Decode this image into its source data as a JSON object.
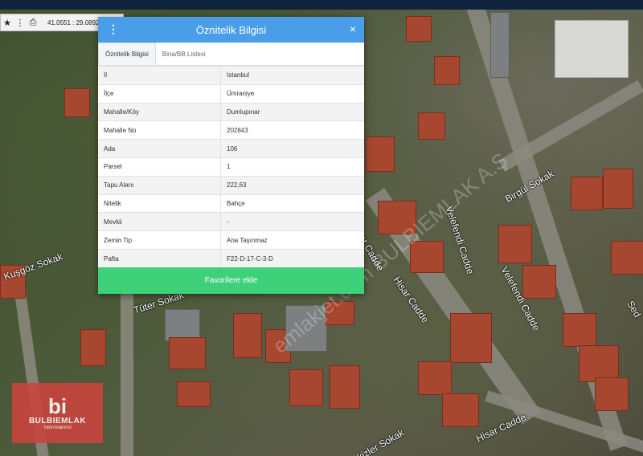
{
  "toolbar": {
    "coords": "41.0551 : 29.0892"
  },
  "dialog": {
    "title": "Öznitelik Bilgisi",
    "close": "×",
    "tabs": [
      "Öznitelik Bilgisi",
      "Bina/BB Listesi"
    ],
    "rows": [
      {
        "key": "İl",
        "value": "İstanbul"
      },
      {
        "key": "İlçe",
        "value": "Ümraniye"
      },
      {
        "key": "Mahalle/Köy",
        "value": "Dumlupınar"
      },
      {
        "key": "Mahalle No",
        "value": "202843"
      },
      {
        "key": "Ada",
        "value": "106"
      },
      {
        "key": "Parsel",
        "value": "1"
      },
      {
        "key": "Tapu Alanı",
        "value": "222,63"
      },
      {
        "key": "Nitelik",
        "value": "Bahçe"
      },
      {
        "key": "Mevkii",
        "value": "-"
      },
      {
        "key": "Zemin Tip",
        "value": "Ana Taşınmaz"
      },
      {
        "key": "Pafta",
        "value": "F22-D-17-C-3-D"
      }
    ],
    "favorite_button": "Favorilere ekle"
  },
  "streets": {
    "birgul": "Birgül Sokak",
    "velefendi1": "Velefendi Cadde",
    "velefendi2": "Velefendi Cadde",
    "hisar1": "Hisar Cadde",
    "hisar2": "Hisar Cadde",
    "tuter": "Tüter Sokak",
    "kusgoz": "Kuşgöz Sokak",
    "ikizler": "İkizler Sokak",
    "sed": "Sed",
    "hisar_cadde_left": "Hisar Cadde"
  },
  "watermark": "emlakjet.com BULBIEMLAK A.Ş",
  "logo": {
    "mark": "bi",
    "name": "BULBIEMLAK",
    "tagline": "Yatırımlarınız"
  }
}
